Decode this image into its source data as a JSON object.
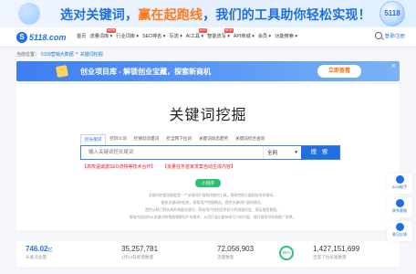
{
  "banner": {
    "text_part1": "选对关键词，",
    "text_highlight": "赢在起跑线",
    "text_part2": "，我们的工具助你轻松实现！",
    "badge": "5118"
  },
  "nav": {
    "logo_text": "5118.com",
    "items": [
      {
        "label": "首页",
        "tag": ""
      },
      {
        "label": "流量词库 ▾",
        "tag": "NEW"
      },
      {
        "label": "行业词库 ▾",
        "tag": ""
      },
      {
        "label": "SEO排名 ▾",
        "tag": ""
      },
      {
        "label": "写流 ▾",
        "tag": ""
      },
      {
        "label": "AI工具 ▾",
        "tag": "HOT"
      },
      {
        "label": "智能流写 ▾",
        "tag": "NEW"
      },
      {
        "label": "API商城 ▾",
        "tag": ""
      },
      {
        "label": "会员 ▾",
        "tag": ""
      },
      {
        "label": "功能搜索 ▾",
        "tag": ""
      }
    ],
    "login_label": "登录/注册"
  },
  "breadcrumb": {
    "prefix": "当前位置：",
    "items": [
      "5118营销大数据",
      ">",
      "关键词挖掘"
    ]
  },
  "promo": {
    "text": "创业项目库 - 解锁创业宝藏，探索新商机",
    "button": "立即查看",
    "close": "✕"
  },
  "main": {
    "title": "关键词挖掘",
    "tabs": [
      "挖长尾词",
      "挖同义词",
      "挖搜动流量词",
      "挖全网下拉词",
      "关键词动态趋势",
      "关键词综合查询"
    ],
    "search_placeholder": "输入关键词挖长尾词",
    "select_value": "全网",
    "search_button": "搜 索",
    "notes": [
      "【高校温诚激SEO流特等技术合作】",
      "【批量任务首家发案自动生成内容】"
    ],
    "mini_button": "小程序",
    "desc_lines": [
      "关键词挖掘功能能是一个关键词扩展和挖掘的工具，帮助挖取大量相关的关键词，",
      "粗收关键词的组合，帮助用户挖掘精品，提供关键词扩展的建议。",
      "提供从热门到长尾的海量关键词，帮助用户找到竞争较小的流量机会，满足搜索意图。",
      "帮助内容创作从关键词的角度理解用户的需求，从而打造出更有吸引力的内容，提升搜索排名和推广效果。"
    ]
  },
  "stats": [
    {
      "value": "746.02",
      "unit": "亿",
      "label": "长尾词总量",
      "accent": true
    },
    {
      "value": "35,257,781",
      "unit": "",
      "label": "1月14日新增数量",
      "accent": false
    },
    {
      "value": "72,056,903",
      "unit": "",
      "label": "流量数量",
      "accent": false,
      "ring": "85%"
    },
    {
      "value": "1,427,151,699",
      "unit": "",
      "label": "百度下拉长尾数量",
      "accent": false
    }
  ],
  "float_panel": [
    "5118助手",
    "联系客服",
    "意见反馈"
  ],
  "colors": {
    "primary": "#1f6fe0",
    "accent": "#ff7a1a",
    "green": "#2fbf71",
    "red": "#e0202a"
  }
}
